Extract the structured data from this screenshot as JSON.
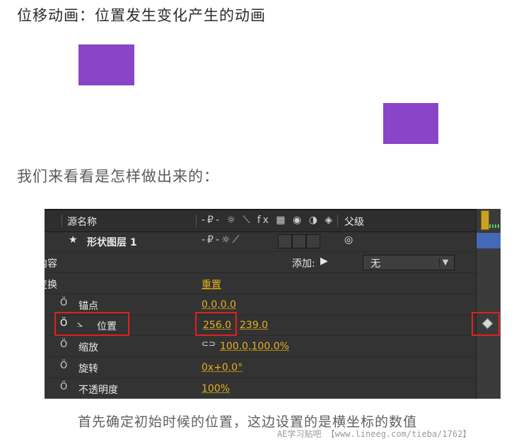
{
  "heading": "位移动画：位置发生变化产生的动画",
  "subheading": "我们来看看是怎样做出来的：",
  "panel": {
    "header": {
      "source_name": "源名称",
      "switch_icons": "-₽- ☼ ⟍ fx ▦ ◉ ◑ ◈",
      "parent": "父级"
    },
    "layer": {
      "star": "★",
      "name": "形状图层 1",
      "parent_value": "无",
      "dropdown_arrow": "▼"
    },
    "contents": {
      "label": "内容",
      "add_label": "添加:",
      "add_icon": "▶"
    },
    "transform": {
      "label": "变换",
      "reset": "重置"
    },
    "properties": [
      {
        "label": "锚点",
        "value": "0.0,0.0"
      },
      {
        "label": "位置",
        "value_x": "256.0",
        "value_y": "239.0",
        "graph_icon": "⦣"
      },
      {
        "label": "缩放",
        "value": "100.0,100.0%",
        "link_icon": "⊂⊃"
      },
      {
        "label": "旋转",
        "value": "0x+0.0°"
      },
      {
        "label": "不透明度",
        "value": "100%"
      }
    ],
    "stopwatch_icon": "Ö"
  },
  "caption": "首先确定初始时候的位置，这边设置的是横坐标的数值",
  "watermark": "AE学习贴吧 【www.lineeg.com/tieba/1762】",
  "colors": {
    "purple": "#8a44c8",
    "accent_yellow": "#e3b21f",
    "highlight_red": "#e02020",
    "panel_bg": "#333333"
  }
}
